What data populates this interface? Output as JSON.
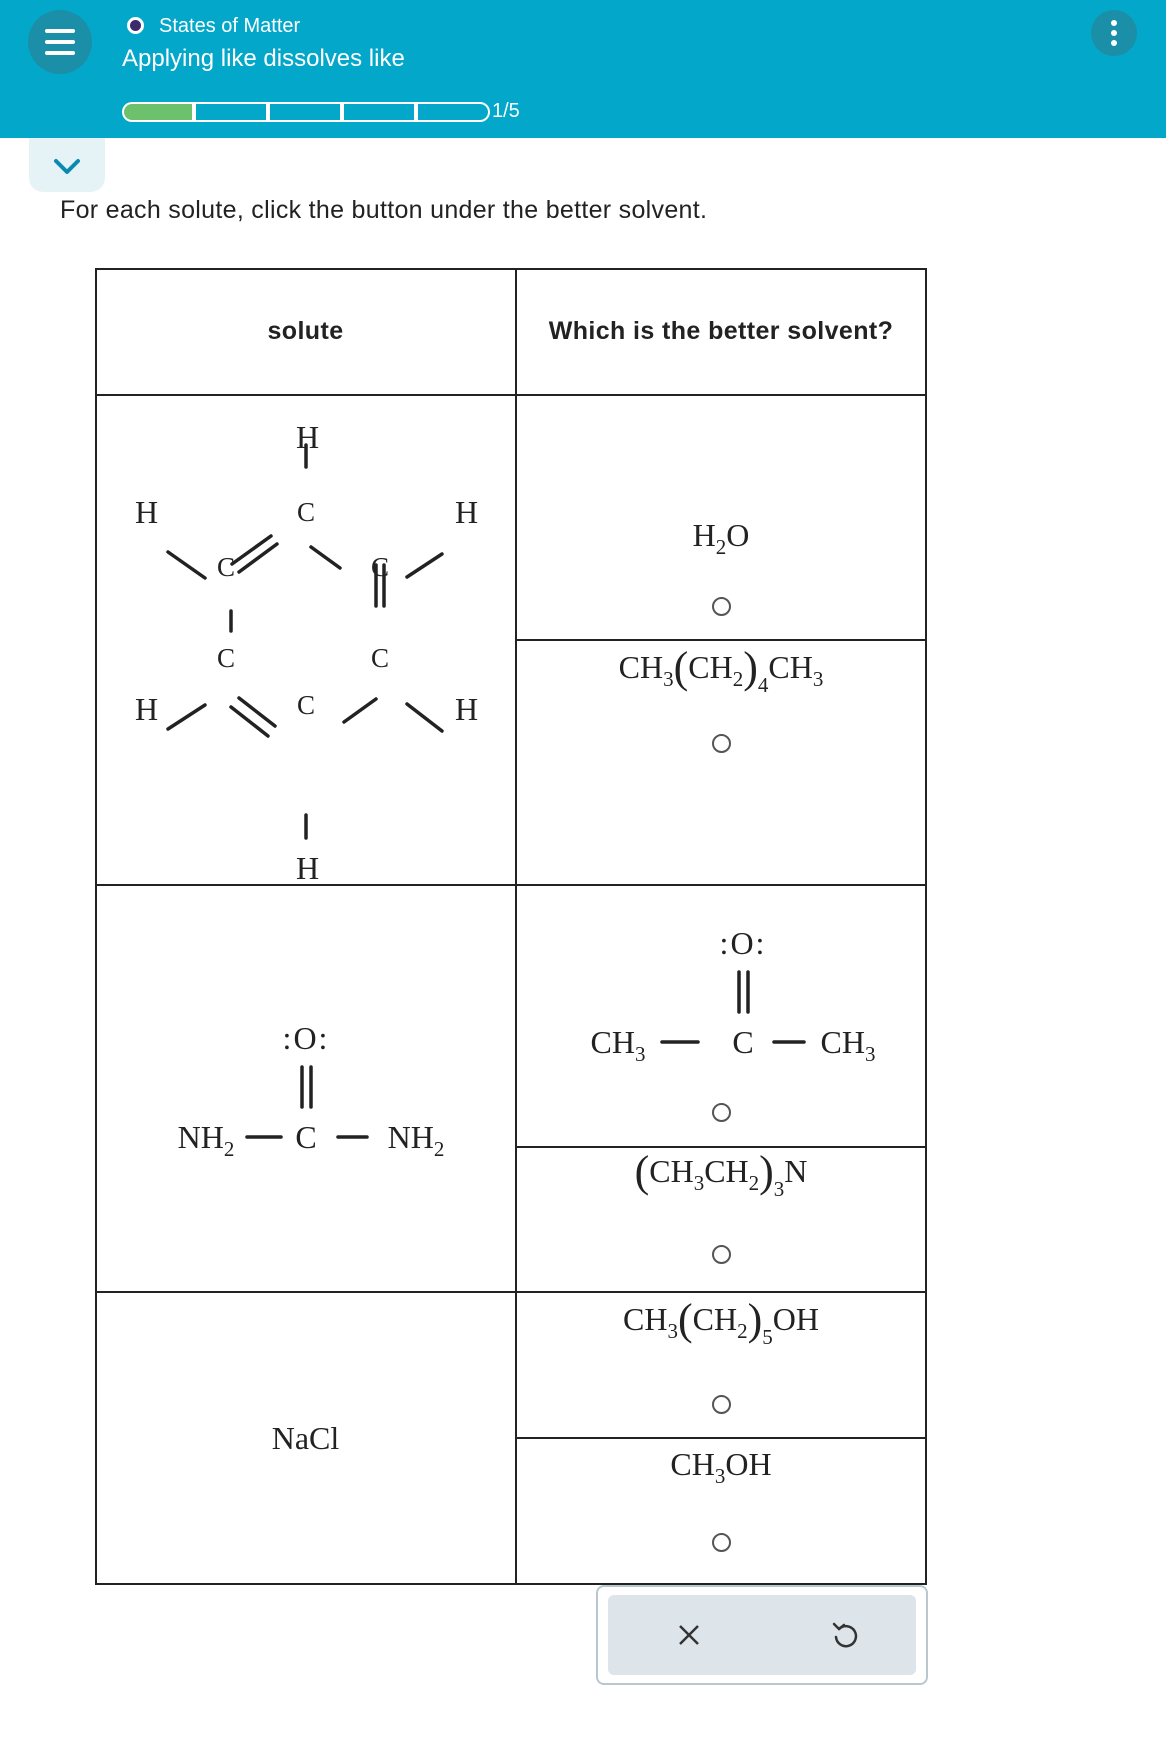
{
  "header": {
    "topic": "States of Matter",
    "lesson": "Applying like dissolves like",
    "progress": {
      "completed": 1,
      "total": 5,
      "label": "1/5"
    },
    "colors": {
      "bar": "#03a7c9",
      "progress_fill": "#6ec16c"
    }
  },
  "instruction": "For each solute, click the button under the better solvent.",
  "table": {
    "headers": {
      "solute": "solute",
      "solvent": "Which is the better solvent?"
    },
    "rows": [
      {
        "solute_atoms": {
          "h": "H",
          "c": "C"
        },
        "option_a": {
          "p1": "H",
          "s1": "2",
          "p2": "O"
        },
        "option_b": {
          "p1": "CH",
          "s1": "3",
          "open": "(",
          "p2": "CH",
          "s2": "2",
          "close": ")",
          "s3": "4",
          "p3": "CH",
          "s4": "3"
        }
      },
      {
        "solute": {
          "o": ":O:",
          "left": "NH",
          "left_sub": "2",
          "c": "C",
          "right": "NH",
          "right_sub": "2"
        },
        "option_a": {
          "o": ":O:",
          "left": "CH",
          "left_sub": "3",
          "c": "C",
          "right": "CH",
          "right_sub": "3"
        },
        "option_b": {
          "open": "(",
          "p1": "CH",
          "s1": "3",
          "p2": "CH",
          "s2": "2",
          "close": ")",
          "s3": "3",
          "p3": "N"
        }
      },
      {
        "solute": {
          "text": "NaCl"
        },
        "option_a": {
          "p1": "CH",
          "s1": "3",
          "open": "(",
          "p2": "CH",
          "s2": "2",
          "close": ")",
          "s3": "5",
          "p3": "OH"
        },
        "option_b": {
          "p1": "CH",
          "s1": "3",
          "p2": "OH"
        }
      }
    ]
  },
  "actions": {
    "clear_icon": "x-icon",
    "undo_icon": "undo-icon"
  }
}
